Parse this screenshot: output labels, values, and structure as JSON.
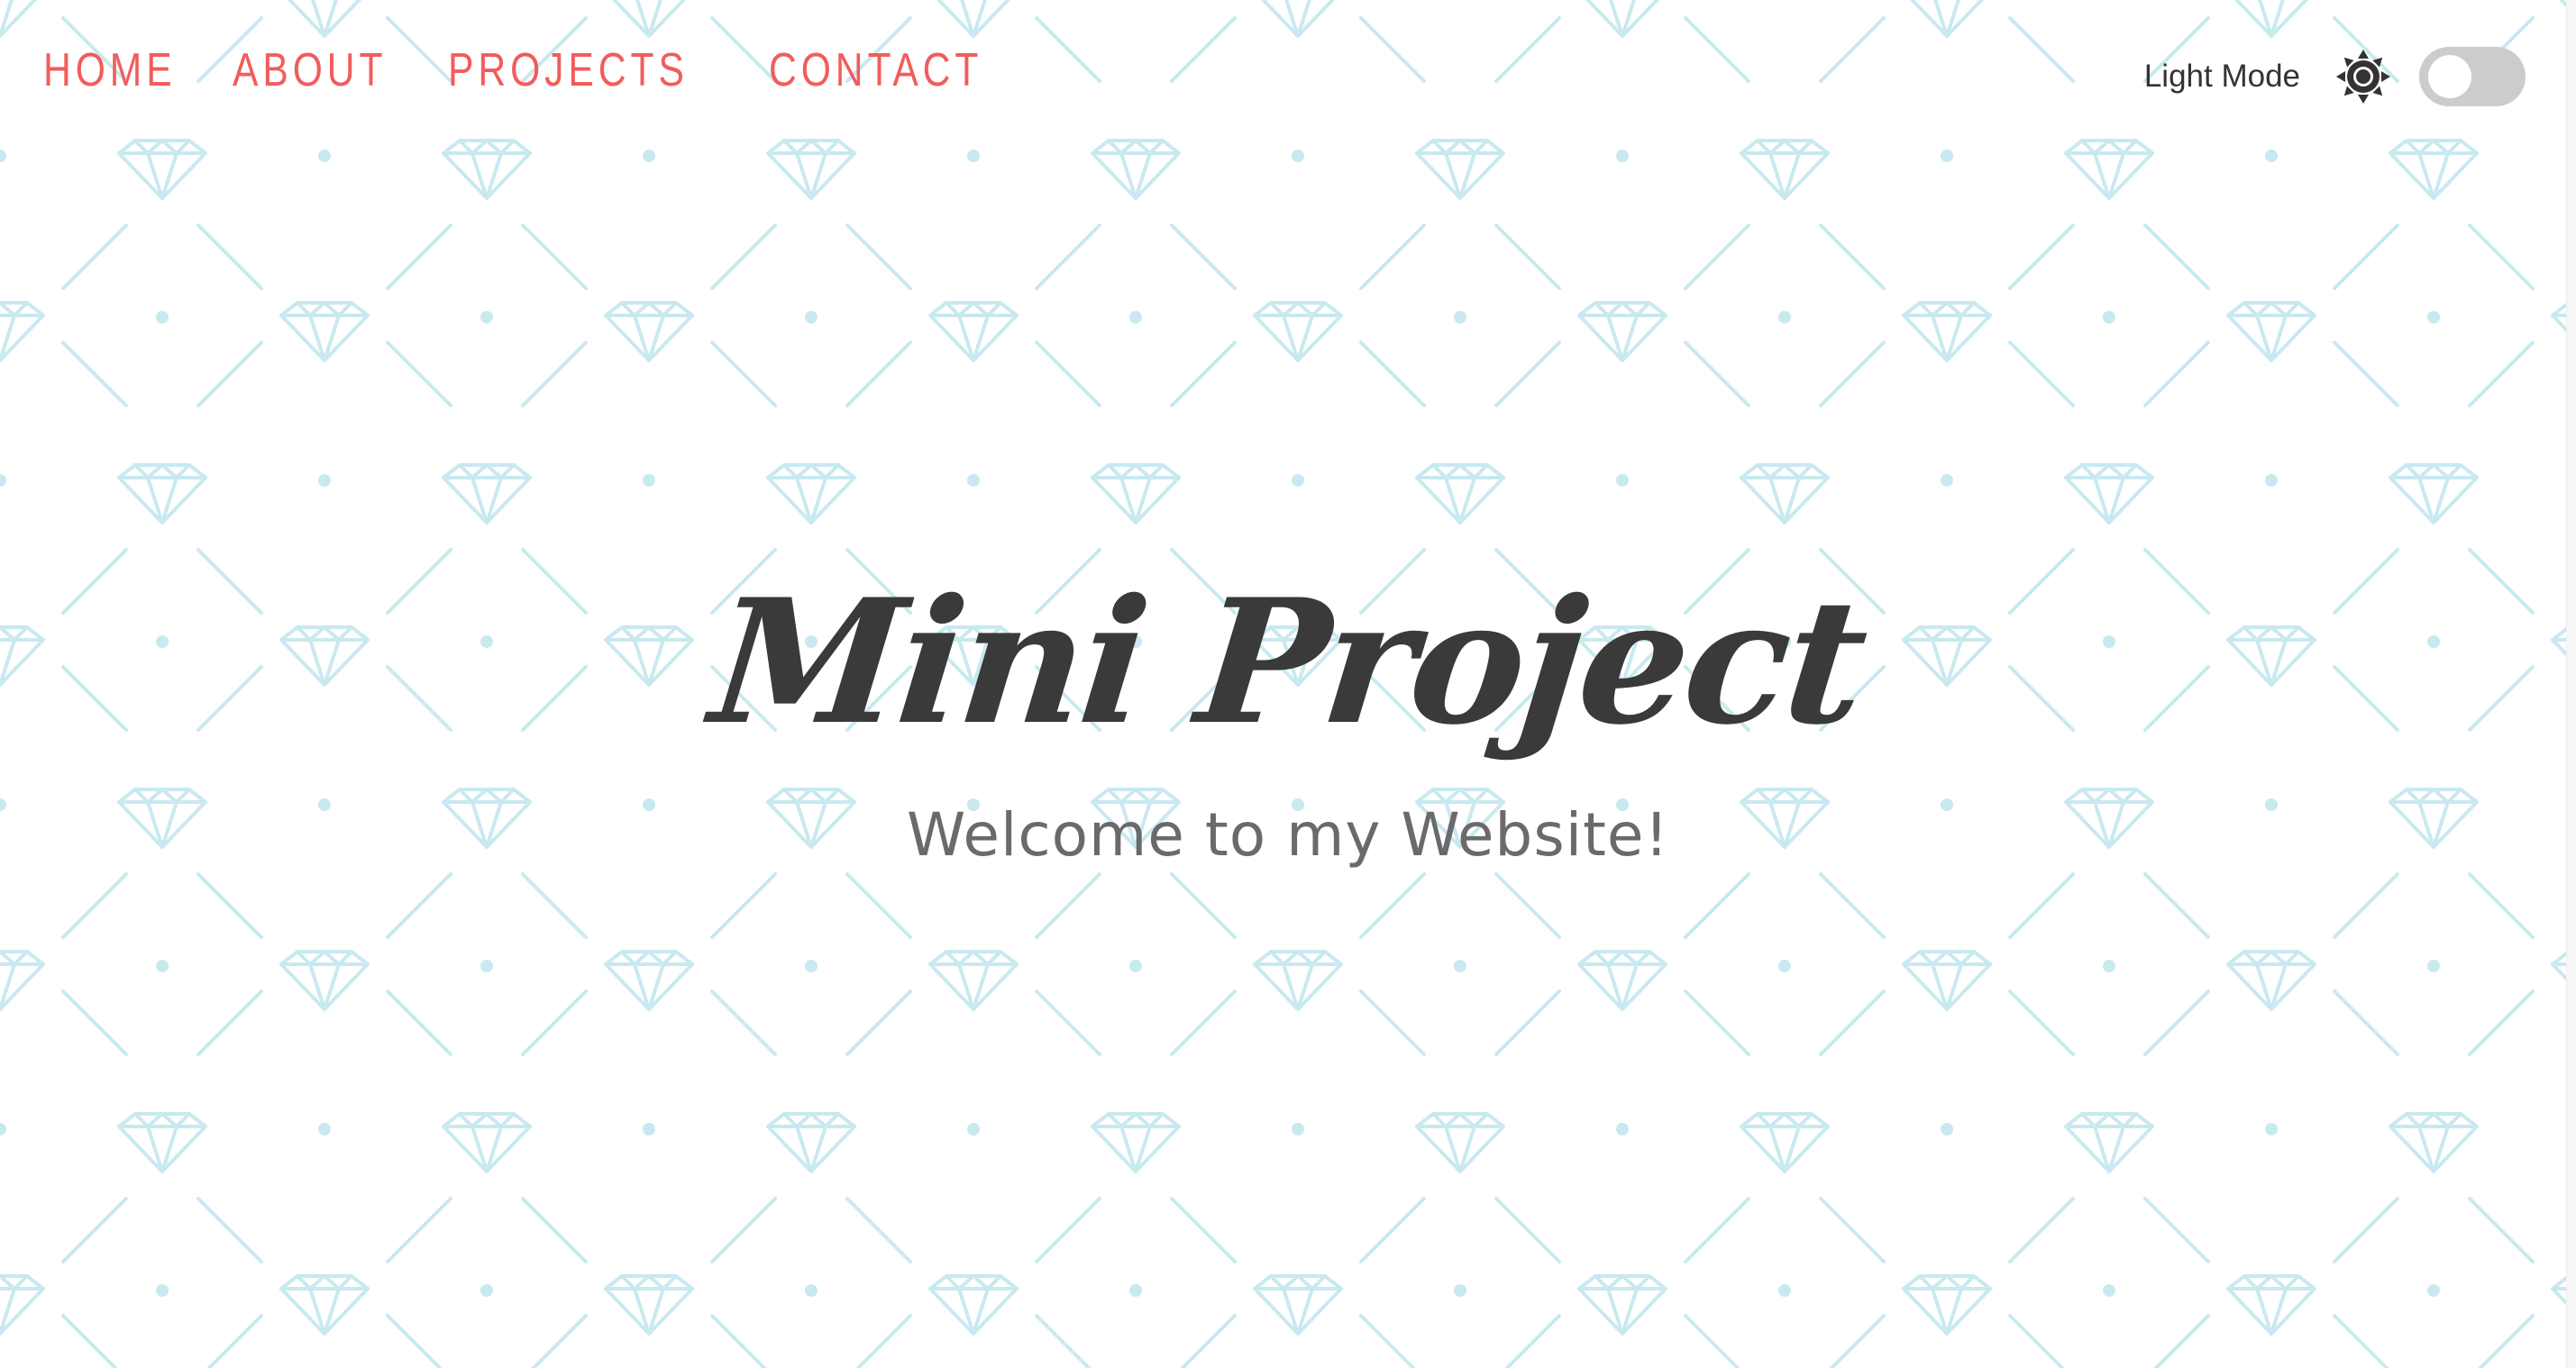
{
  "nav": {
    "items": [
      {
        "label": "HOME"
      },
      {
        "label": "ABOUT"
      },
      {
        "label": "PROJECTS"
      },
      {
        "label": "CONTACT"
      }
    ]
  },
  "theme": {
    "label": "Light Mode",
    "icon": "sun-icon",
    "dark_mode_enabled": false
  },
  "hero": {
    "title": "Mini Project",
    "subtitle": "Welcome to my Website!"
  },
  "colors": {
    "nav_link": "#f25c5c",
    "pattern": "#c8e9ef",
    "title": "#3a3a3a",
    "subtitle": "#6a6a6a",
    "toggle_off": "#cccccc"
  }
}
